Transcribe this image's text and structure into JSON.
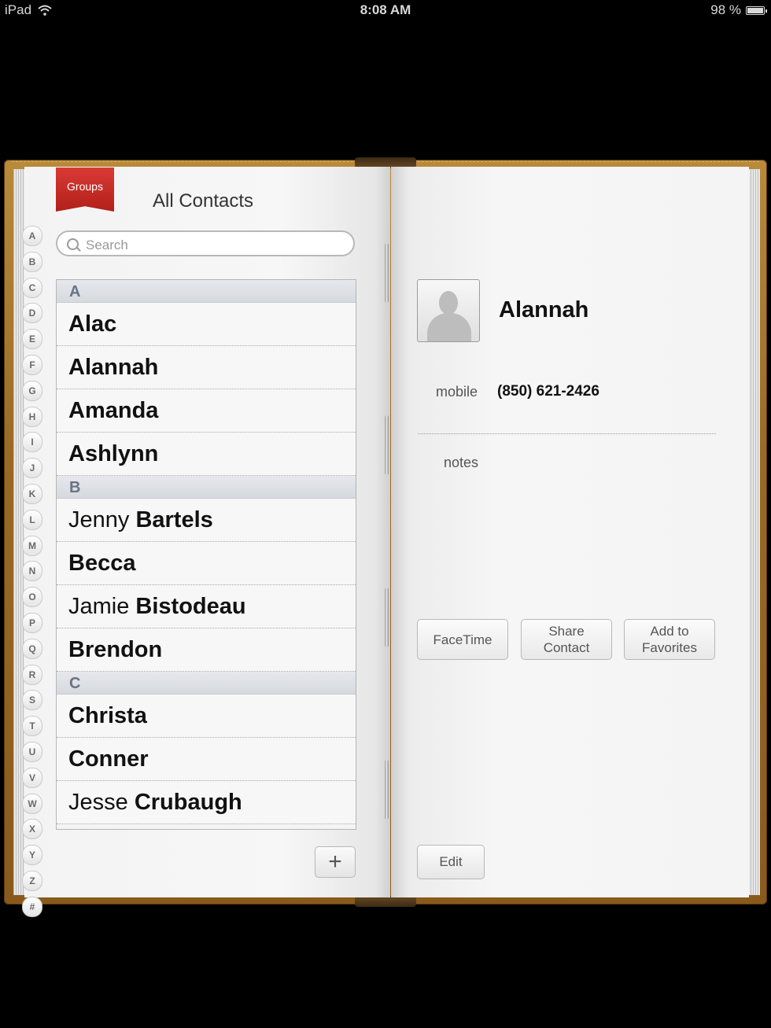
{
  "status_bar": {
    "device": "iPad",
    "time": "8:08 AM",
    "battery": "98 %",
    "battery_level": 0.98
  },
  "left_page": {
    "groups_label": "Groups",
    "title": "All Contacts",
    "search_placeholder": "Search",
    "index_letters": [
      "A",
      "B",
      "C",
      "D",
      "E",
      "F",
      "G",
      "H",
      "I",
      "J",
      "K",
      "L",
      "M",
      "N",
      "O",
      "P",
      "Q",
      "R",
      "S",
      "T",
      "U",
      "V",
      "W",
      "X",
      "Y",
      "Z",
      "#"
    ],
    "sections": [
      {
        "header": "A",
        "contacts": [
          {
            "first": "",
            "last": "Alac"
          },
          {
            "first": "",
            "last": "Alannah"
          },
          {
            "first": "",
            "last": "Amanda"
          },
          {
            "first": "",
            "last": "Ashlynn"
          }
        ]
      },
      {
        "header": "B",
        "contacts": [
          {
            "first": "Jenny",
            "last": "Bartels"
          },
          {
            "first": "",
            "last": "Becca"
          },
          {
            "first": "Jamie",
            "last": "Bistodeau"
          },
          {
            "first": "",
            "last": "Brendon"
          }
        ]
      },
      {
        "header": "C",
        "contacts": [
          {
            "first": "",
            "last": "Christa"
          },
          {
            "first": "",
            "last": "Conner"
          },
          {
            "first": "Jesse",
            "last": "Crubaugh"
          }
        ]
      }
    ],
    "add_label": "+"
  },
  "right_page": {
    "name": "Alannah",
    "mobile_label": "mobile",
    "mobile_value": "(850) 621-2426",
    "notes_label": "notes",
    "facetime_label": "FaceTime",
    "share_label_1": "Share",
    "share_label_2": "Contact",
    "favorites_label_1": "Add to",
    "favorites_label_2": "Favorites",
    "edit_label": "Edit"
  }
}
